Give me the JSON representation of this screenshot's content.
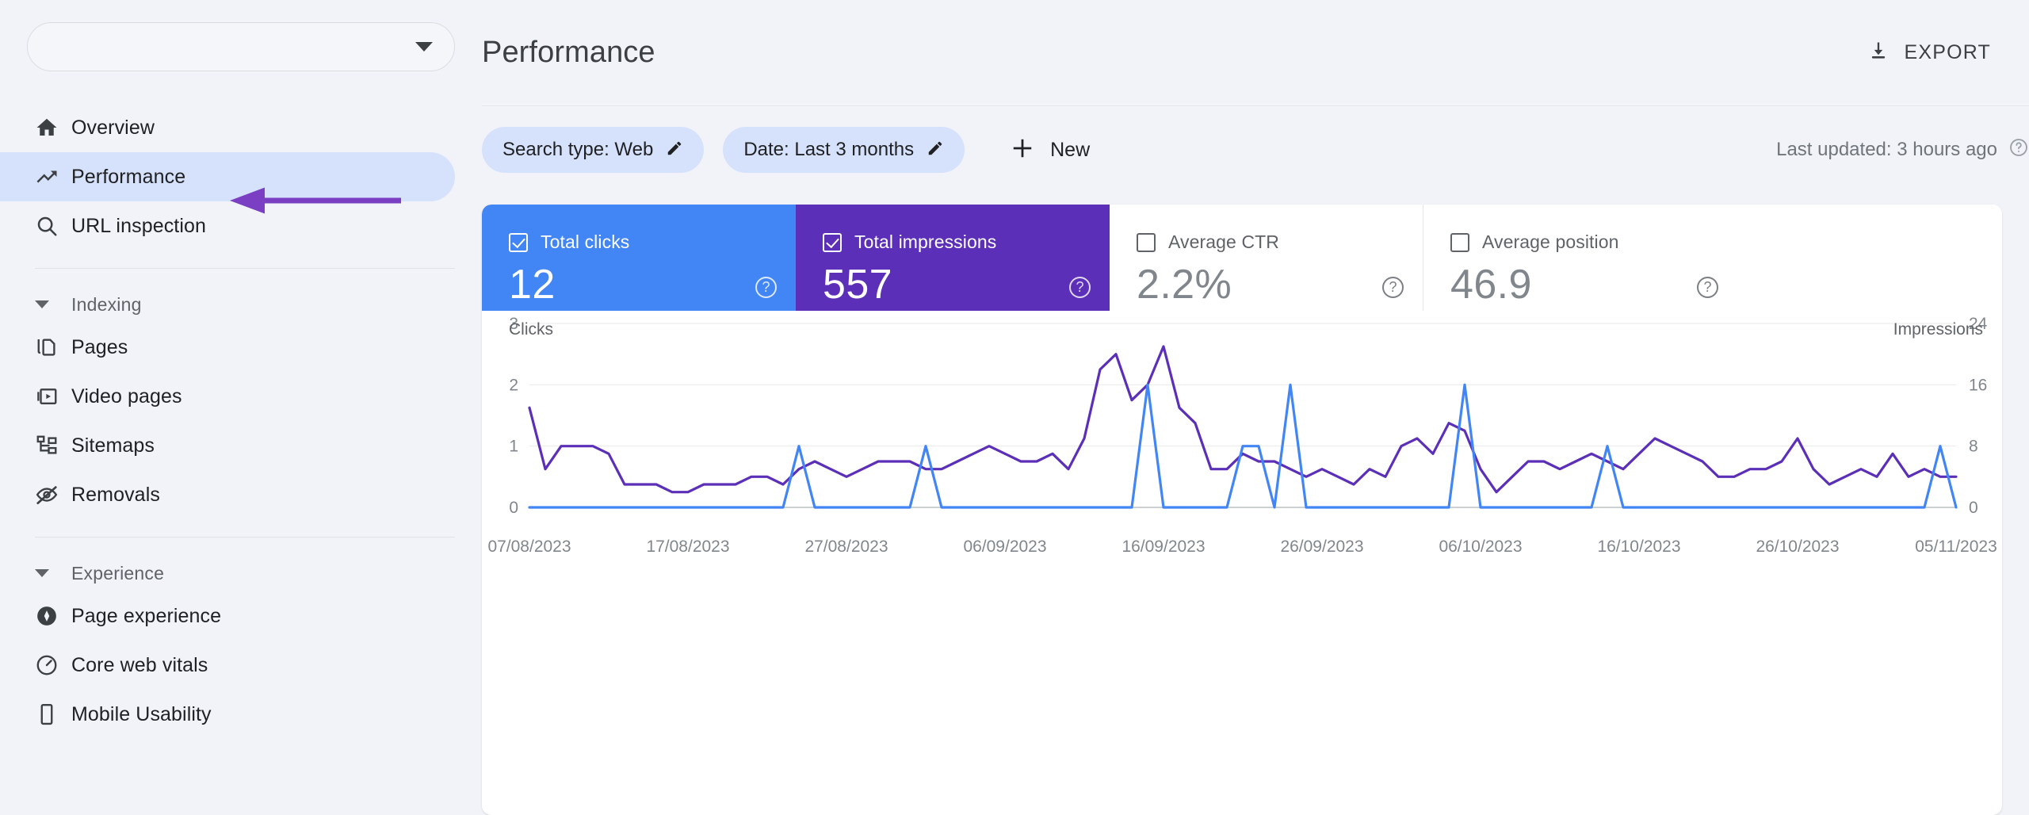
{
  "sidebar": {
    "property": {
      "name_redacted": "",
      "caret_icon": "chevron-down-icon"
    },
    "items": [
      {
        "label": "Overview",
        "icon": "home-icon",
        "active": false
      },
      {
        "label": "Performance",
        "icon": "trending-up-icon",
        "active": true
      },
      {
        "label": "URL inspection",
        "icon": "search-icon",
        "active": false
      }
    ],
    "groups": [
      {
        "label": "Indexing",
        "items": [
          {
            "label": "Pages",
            "icon": "pages-copy-icon"
          },
          {
            "label": "Video pages",
            "icon": "video-icon"
          },
          {
            "label": "Sitemaps",
            "icon": "sitemap-icon"
          },
          {
            "label": "Removals",
            "icon": "eye-off-icon"
          }
        ]
      },
      {
        "label": "Experience",
        "items": [
          {
            "label": "Page experience",
            "icon": "page-experience-icon"
          },
          {
            "label": "Core web vitals",
            "icon": "speedometer-icon"
          },
          {
            "label": "Mobile Usability",
            "icon": "mobile-icon"
          }
        ]
      }
    ]
  },
  "header": {
    "title": "Performance",
    "export_label": "EXPORT",
    "export_icon": "download-icon"
  },
  "filters": {
    "chips": [
      {
        "label": "Search type: Web",
        "edit_icon": "pencil-icon"
      },
      {
        "label": "Date: Last 3 months",
        "edit_icon": "pencil-icon"
      }
    ],
    "new_label": "New",
    "new_icon": "plus-icon",
    "last_updated": "Last updated: 3 hours ago",
    "help_icon": "help-circle-icon"
  },
  "metrics": [
    {
      "label": "Total clicks",
      "value": "12",
      "checked": true,
      "color": "#4285F4",
      "help_icon": "help-circle-icon"
    },
    {
      "label": "Total impressions",
      "value": "557",
      "checked": true,
      "color": "#5C2FB8",
      "help_icon": "help-circle-icon"
    },
    {
      "label": "Average CTR",
      "value": "2.2%",
      "checked": false,
      "color": "#FFFFFF",
      "help_icon": "help-circle-icon"
    },
    {
      "label": "Average position",
      "value": "46.9",
      "checked": false,
      "color": "#FFFFFF",
      "help_icon": "help-circle-icon"
    }
  ],
  "chart_data": {
    "type": "line",
    "title": "",
    "xlabel": "",
    "ylabel": "Clicks",
    "y2label": "Impressions",
    "left_axis_name": "Clicks",
    "right_axis_name": "Impressions",
    "left_ticks": [
      0,
      1,
      2,
      3
    ],
    "right_ticks": [
      0,
      8,
      16,
      24
    ],
    "ylim": [
      0,
      3
    ],
    "y2lim": [
      0,
      24
    ],
    "grid": true,
    "legend_position": "none",
    "x_tick_labels": [
      "07/08/2023",
      "17/08/2023",
      "27/08/2023",
      "06/09/2023",
      "16/09/2023",
      "26/09/2023",
      "06/10/2023",
      "16/10/2023",
      "26/10/2023",
      "05/11/2023"
    ],
    "series": [
      {
        "name": "Clicks",
        "color": "#4285F4",
        "axis": "left",
        "values": [
          0,
          0,
          0,
          0,
          0,
          0,
          0,
          0,
          0,
          0,
          0,
          0,
          0,
          0,
          0,
          0,
          0,
          1,
          0,
          0,
          0,
          0,
          0,
          0,
          0,
          1,
          0,
          0,
          0,
          0,
          0,
          0,
          0,
          0,
          0,
          0,
          0,
          0,
          0,
          2,
          0,
          0,
          0,
          0,
          0,
          1,
          1,
          0,
          2,
          0,
          0,
          0,
          0,
          0,
          0,
          0,
          0,
          0,
          0,
          2,
          0,
          0,
          0,
          0,
          0,
          0,
          0,
          0,
          1,
          0,
          0,
          0,
          0,
          0,
          0,
          0,
          0,
          0,
          0,
          0,
          0,
          0,
          0,
          0,
          0,
          0,
          0,
          0,
          0,
          1,
          0
        ]
      },
      {
        "name": "Impressions",
        "color": "#5C2FB8",
        "axis": "right",
        "values": [
          13,
          5,
          8,
          8,
          8,
          7,
          3,
          3,
          3,
          2,
          2,
          3,
          3,
          3,
          4,
          4,
          3,
          5,
          6,
          5,
          4,
          5,
          6,
          6,
          6,
          5,
          5,
          6,
          7,
          8,
          7,
          6,
          6,
          7,
          5,
          9,
          18,
          20,
          14,
          16,
          21,
          13,
          11,
          5,
          5,
          7,
          6,
          6,
          5,
          4,
          5,
          4,
          3,
          5,
          4,
          8,
          9,
          7,
          11,
          10,
          5,
          2,
          4,
          6,
          6,
          5,
          6,
          7,
          6,
          5,
          7,
          9,
          8,
          7,
          6,
          4,
          4,
          5,
          5,
          6,
          9,
          5,
          3,
          4,
          5,
          4,
          7,
          4,
          5,
          4,
          4
        ]
      }
    ]
  }
}
